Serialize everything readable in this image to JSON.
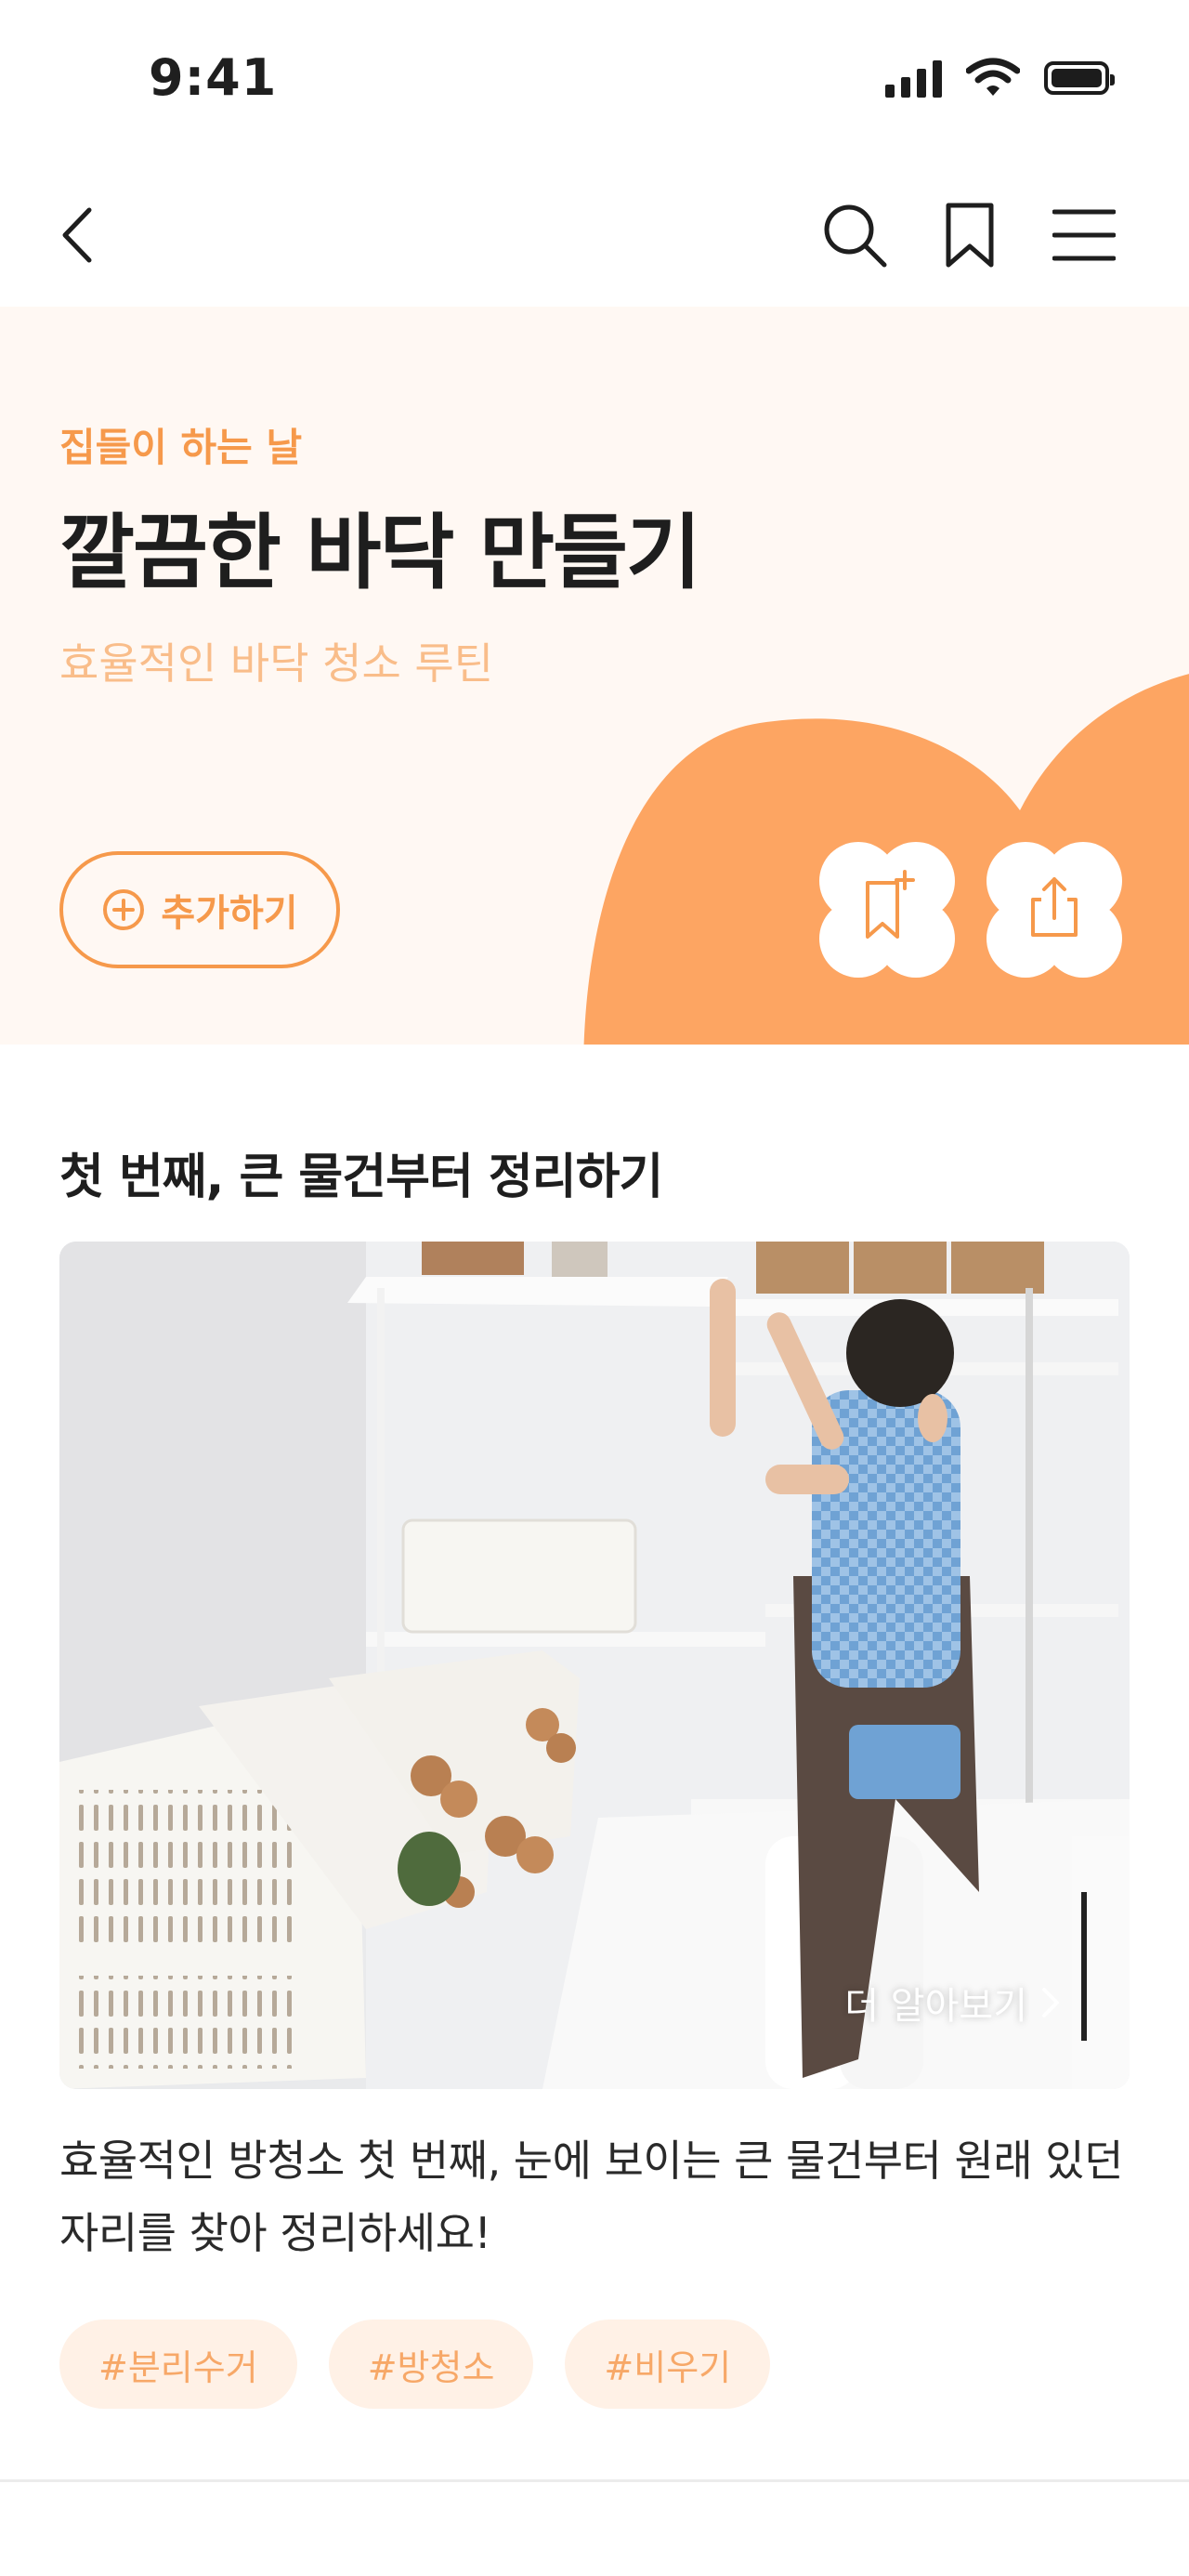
{
  "status_bar": {
    "time": "9:41"
  },
  "nav": {
    "back_icon": "chevron-left-icon",
    "search_icon": "search-icon",
    "bookmark_icon": "bookmark-icon",
    "menu_icon": "hamburger-menu-icon"
  },
  "hero": {
    "tag": "집들이 하는 날",
    "title": "깔끔한 바닥 만들기",
    "subtitle": "효율적인 바닥 청소 루틴",
    "add_button_label": "추가하기",
    "actions": [
      "bookmark-add-icon",
      "share-icon"
    ],
    "colors": {
      "accent": "#f6994b",
      "background": "#fff8f3",
      "blob": "#fda562"
    }
  },
  "section": {
    "title": "첫 번째, 큰 물건부터 정리하기",
    "more_link": "더 알아보기",
    "description": "효율적인 방청소 첫 번째, 눈에 보이는 큰 물건부터 원래 있던 자리를 찾아 정리하세요!",
    "tags": [
      "#분리수거",
      "#방청소",
      "#비우기"
    ]
  }
}
